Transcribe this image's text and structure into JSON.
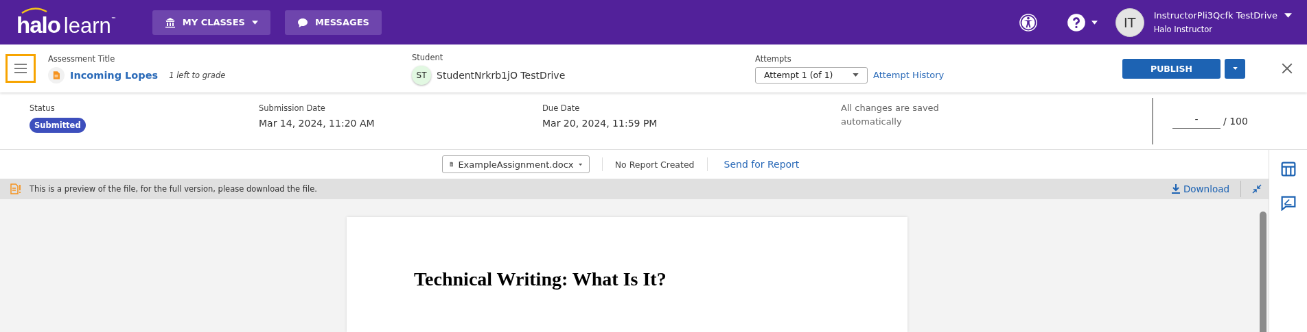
{
  "brand": {
    "logo_main": "halo",
    "logo_sub": "learn",
    "trademark": "™"
  },
  "nav": [
    {
      "label": "MY CLASSES",
      "kind": "dropdown"
    },
    {
      "label": "MESSAGES",
      "kind": "plain"
    }
  ],
  "user": {
    "initials": "IT",
    "name": "InstructorPli3Qcfk TestDrive",
    "role": "Halo Instructor"
  },
  "assessment": {
    "label": "Assessment Title",
    "title": "Incoming Lopes",
    "note": "1 left to grade"
  },
  "student": {
    "label": "Student",
    "initials": "ST",
    "name": "StudentNrkrb1jO TestDrive"
  },
  "attempts": {
    "label": "Attempts",
    "value": "Attempt 1 (of 1)",
    "history": "Attempt History"
  },
  "publish": "PUBLISH",
  "info": [
    {
      "label": "Status",
      "value": "Submitted",
      "kind": "badge"
    },
    {
      "label": "Submission Date",
      "value": "Mar 14, 2024, 11:20 AM",
      "kind": "text"
    },
    {
      "label": "Due Date",
      "value": "Mar 20, 2024, 11:59 PM",
      "kind": "text"
    }
  ],
  "save_note": "All changes are saved automatically",
  "score": {
    "value": "-",
    "total": "/ 100"
  },
  "file": {
    "name": "ExampleAssignment.docx",
    "report_status": "No Report Created",
    "report_link": "Send for Report"
  },
  "preview_notice": "This is a preview of the file, for the full version, please download the file.",
  "download": "Download",
  "document": {
    "heading": "Technical Writing: What Is It?"
  }
}
